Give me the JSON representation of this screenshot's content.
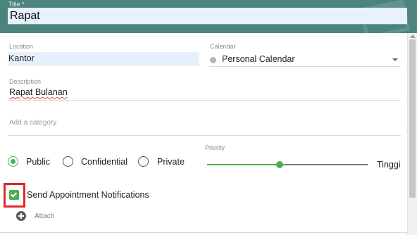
{
  "title_field": {
    "label": "Title *",
    "value": "Rapat"
  },
  "location_field": {
    "label": "Location",
    "value": "Kantor"
  },
  "calendar_field": {
    "label": "Calendar",
    "value": "Personal Calendar",
    "dot_color": "#b5b5b5"
  },
  "description_field": {
    "label": "Description",
    "value": "Rapat Bulanan"
  },
  "category_field": {
    "placeholder": "Add a category"
  },
  "visibility": {
    "options": [
      {
        "label": "Public",
        "selected": true
      },
      {
        "label": "Confidential",
        "selected": false
      },
      {
        "label": "Private",
        "selected": false
      }
    ]
  },
  "priority": {
    "label": "Priority",
    "value_label": "Tinggi",
    "level": 0.45
  },
  "notifications": {
    "label": "Send Appointment Notifications",
    "checked": true
  },
  "attach": {
    "label": "Attach"
  },
  "colors": {
    "header": "#4b847c",
    "accent": "#4caf50",
    "highlight": "#e0292b",
    "autofill": "#e8f0fe"
  }
}
